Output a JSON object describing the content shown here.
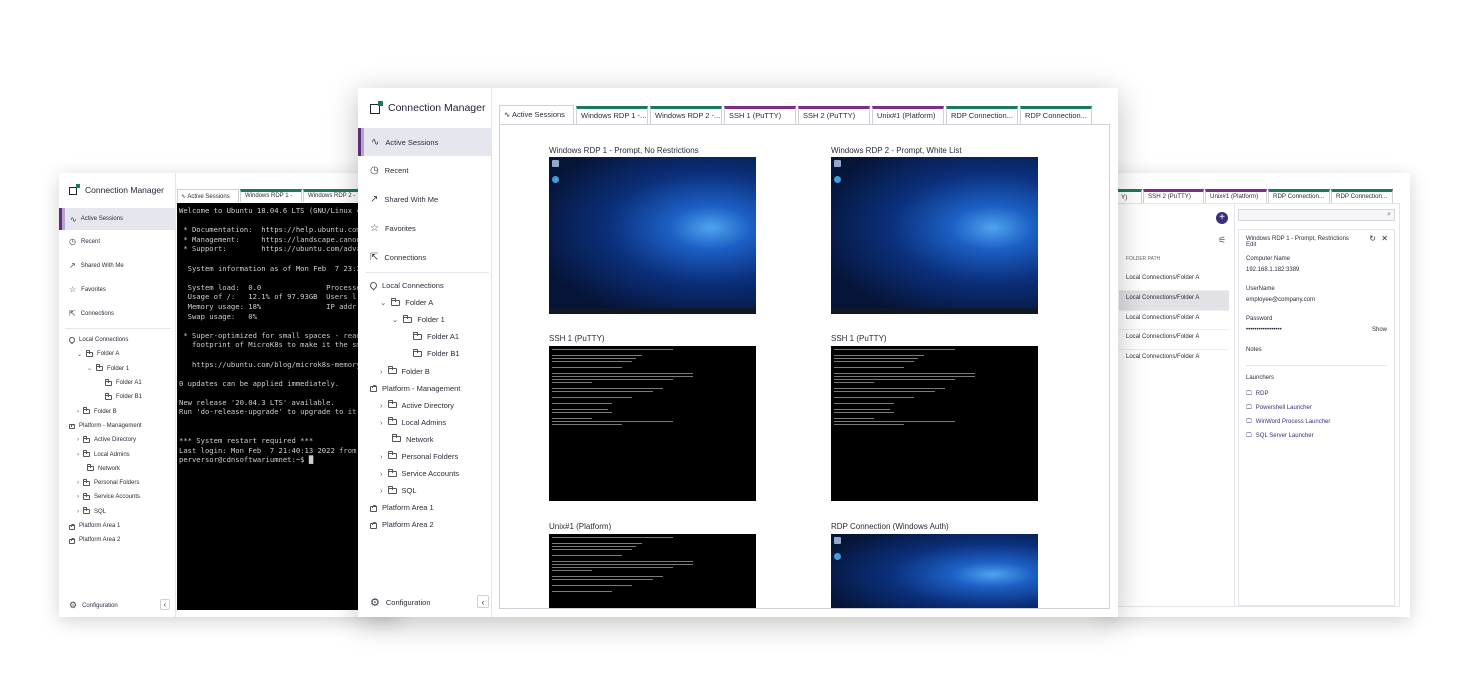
{
  "app": {
    "title": "Connection Manager"
  },
  "nav": {
    "active_sessions": "Active Sessions",
    "recent": "Recent",
    "shared": "Shared With Me",
    "favorites": "Favorites",
    "connections": "Connections",
    "configuration": "Configuration"
  },
  "tree": {
    "local_connections": "Local Connections",
    "folder_a": "Folder A",
    "folder_1": "Folder 1",
    "folder_a1": "Folder A1",
    "folder_b1": "Folder B1",
    "folder_b": "Folder B",
    "platform_management": "Platform - Management",
    "active_directory": "Active Directory",
    "local_admins": "Local Admins",
    "network": "Network",
    "personal_folders": "Personal Folders",
    "service_accounts": "Service Accounts",
    "sql": "SQL",
    "platform_area_1": "Platform Area 1",
    "platform_area_2": "Platform Area 2"
  },
  "tabs": {
    "active_sessions": "Active Sessions",
    "win_rdp_1": "Windows RDP 1 -...",
    "win_rdp_2": "Windows RDP 2 -...",
    "ssh_1": "SSH 1 (PuTTY)",
    "ssh_2": "SSH 2 (PuTTY)",
    "unix_1": "Unix#1 (Platform)",
    "rdp_conn_1": "RDP Connection...",
    "rdp_conn_2": "RDP Connection...",
    "left_win_rdp_1": "Windows RDP 1 -",
    "left_win_rdp_2": "Windows RDP 2 -",
    "right_partial": "Y)"
  },
  "sessions": [
    {
      "title": "Windows RDP 1 - Prompt, No Restrictions",
      "kind": "desktop"
    },
    {
      "title": "Windows RDP 2 - Prompt, White List",
      "kind": "desktop"
    },
    {
      "title": "SSH 1 (PuTTY)",
      "kind": "terminal"
    },
    {
      "title": "SSH 1 (PuTTY)",
      "kind": "terminal"
    },
    {
      "title": "Unix#1 (Platform)",
      "kind": "terminal"
    },
    {
      "title": "RDP Connection (Windows Auth)",
      "kind": "desktop"
    }
  ],
  "terminal": {
    "lines": [
      "Welcome to Ubuntu 18.04.6 LTS (GNU/Linux 4",
      "",
      " * Documentation:  https://help.ubuntu.com",
      " * Management:     https://landscape.canon",
      " * Support:        https://ubuntu.com/adva",
      "",
      "  System information as of Mon Feb  7 23:3",
      "",
      "  System load:  0.0               Processe",
      "  Usage of /:   12.1% of 97.93GB  Users l",
      "  Memory usage: 18%               IP addr",
      "  Swap usage:   0%",
      "",
      " * Super-optimized for small spaces - read",
      "   footprint of MicroK8s to make it the sm",
      "",
      "   https://ubuntu.com/blog/microk8s-memory",
      "",
      "0 updates can be applied immediately.",
      "",
      "New release '20.04.3 LTS' available.",
      "Run 'do-release-upgrade' to upgrade to it.",
      "",
      "",
      "*** System restart required ***",
      "Last login: Mon Feb  7 21:40:13 2022 from",
      "perversor@cdnsoftwariumnet:~$ "
    ]
  },
  "right_panel": {
    "folder_path_header": "FOLDER PATH",
    "rows": [
      "Local Connections/Folder A",
      "Local Connections/Folder A",
      "Local Connections/Folder A",
      "Local Connections/Folder A",
      "Local Connections/Folder A"
    ],
    "details": {
      "title": "Windows RDP 1 - Prompt, Restrictions",
      "edit": "Edit",
      "computer_name_label": "Computer Name",
      "computer_name": "192.168.1.182:3389",
      "username_label": "UserName",
      "username": "employee@company.com",
      "password_label": "Password",
      "password": "•••••••••••••••••",
      "show": "Show",
      "notes_label": "Notes",
      "launchers_label": "Launchers",
      "launchers": [
        "RDP",
        "Powershell Launcher",
        "WinWord Process Launcher",
        "SQL Server Launcher"
      ]
    }
  },
  "colors": {
    "accent_purple": "#5b2d7a",
    "accent_green": "#1a7a5a",
    "ssh_purple": "#7a2d8a"
  }
}
